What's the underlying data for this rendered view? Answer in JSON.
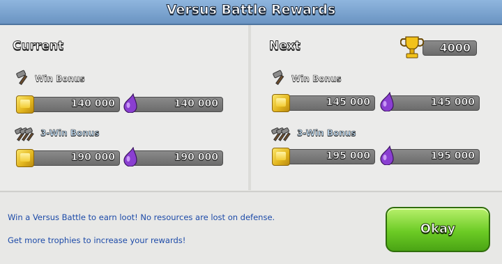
{
  "title": "Versus Battle Rewards",
  "current": {
    "heading": "Current",
    "win_bonus": {
      "label": "Win Bonus",
      "gold": "140 000",
      "elixir": "140 000"
    },
    "three_win_bonus": {
      "label": "3-Win Bonus",
      "gold": "190 000",
      "elixir": "190 000"
    }
  },
  "next": {
    "heading": "Next",
    "trophies": "4000",
    "win_bonus": {
      "label": "Win Bonus",
      "gold": "145 000",
      "elixir": "145 000"
    },
    "three_win_bonus": {
      "label": "3-Win Bonus",
      "gold": "195 000",
      "elixir": "195 000"
    }
  },
  "footer": {
    "line1": "Win a Versus Battle to earn loot! No resources are lost on defense.",
    "line2": "Get more trophies to increase your rewards!"
  },
  "okay_label": "Okay",
  "icons": [
    "hammer-icon",
    "gold-icon",
    "elixir-icon",
    "trophy-icon"
  ],
  "colors": {
    "title_bar": "#7aa3d0",
    "okay_button": "#6ccb25",
    "info_text": "#1c4aa8",
    "gold": "#e1b41d",
    "elixir": "#8a3fd1"
  }
}
